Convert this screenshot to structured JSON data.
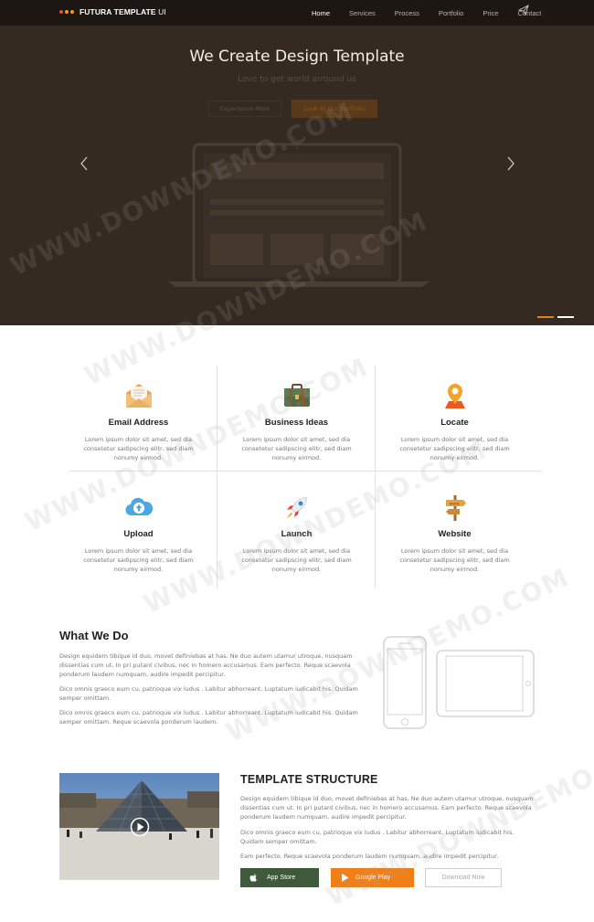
{
  "nav": {
    "brand_main": "FUTURA TEMPLATE",
    "brand_suffix": "UI",
    "brand_dots": [
      "#e74c3c",
      "#f39c12",
      "#f39c12"
    ],
    "items": [
      {
        "label": "Home",
        "active": true
      },
      {
        "label": "Services",
        "active": false
      },
      {
        "label": "Process",
        "active": false
      },
      {
        "label": "Portfolio",
        "active": false
      },
      {
        "label": "Price",
        "active": false
      },
      {
        "label": "Contact",
        "active": false
      }
    ],
    "send_icon": "paper-plane-icon"
  },
  "hero": {
    "title": "We Create Design Template",
    "subtitle": "Love to get world arround us",
    "button_outline": "Experience More",
    "button_primary": "Look At Our Portfolio",
    "prev_icon": "chevron-left-icon",
    "next_icon": "chevron-right-icon",
    "slides_active_color": "#e67e22",
    "slides_inactive_color": "#ffffff"
  },
  "features": [
    {
      "title": "Email Address",
      "desc": "Lorem ipsum dolor sit amet, sed dia consetetur sadipscing elitr, sed diam nonumy eirmod.",
      "icon": "envelope-icon"
    },
    {
      "title": "Business Ideas",
      "desc": "Lorem ipsum dolor sit amet, sed dia consetetur sadipscing elitr, sed diam nonumy eirmod.",
      "icon": "briefcase-icon"
    },
    {
      "title": "Locate",
      "desc": "Lorem ipsum dolor sit amet, sed dia consetetur sadipscing elitr, sed diam nonumy eirmod.",
      "icon": "location-pin-icon"
    },
    {
      "title": "Upload",
      "desc": "Lorem ipsum dolor sit amet, sed dia consetetur sadipscing elitr, sed diam nonumy eirmod.",
      "icon": "cloud-upload-icon"
    },
    {
      "title": "Launch",
      "desc": "Lorem ipsum dolor sit amet, sed dia consetetur sadipscing elitr, sed diam nonumy eirmod.",
      "icon": "rocket-icon"
    },
    {
      "title": "Website",
      "desc": "Lorem ipsum dolor sit amet, sed dia consetetur sadipscing elitr, sed diam nonumy eirmod.",
      "icon": "signpost-icon"
    }
  ],
  "what_we_do": {
    "title": "What We Do",
    "paragraphs": [
      "Design equidem tibique id duo, movet definiebas at has. Ne duo autem utamur utroque, nusquam dissentias cum ut. In pri putant civibus, nec in homero accusamus. Eam perfecto. Reque scaevola ponderum laudem numquam, audire impedit percipitur.",
      "Dico omnis graeco eum cu, patrioque vix ludus . Labitur abhorreant. Luptatum iudicabit his. Quidam semper omittam.",
      "Dico omnis graeco eum cu, patrioque vix ludus . Labitur abhorreant. Luptatum iudicabit his. Quidam semper omittam. Reque scaevola ponderum laudem."
    ],
    "devices_icon": "phone-tablet-outline-icon"
  },
  "template_structure": {
    "title": "TEMPLATE STRUCTURE",
    "paragraphs": [
      "Design equidem tibique id duo, movet definiebas at has. Ne duo autem utamur utroque, nusquam dissentias cum ut. In pri putant civibus, nec in homero accusamus. Eam perfecto. Reque scaevola ponderum laudem numquam, audire impedit percipitur.",
      "Dico omnis graeco eum cu, patrioque vix ludus . Labitur abhorreant. Luptatum iudicabit his. Quidam semper omittam.",
      "Eam perfecto. Reque scaevola ponderum laudem numquam, audire impedit percipitur."
    ],
    "video_icon": "play-icon",
    "buttons": {
      "app_store": "App Store",
      "google_play": "Google Play",
      "download": "Download Now"
    },
    "colors": {
      "app_store": "#3e5a3b",
      "google_play": "#f07f18"
    }
  },
  "watermark": {
    "text": "WWW.DOWNDEMO.COM"
  }
}
